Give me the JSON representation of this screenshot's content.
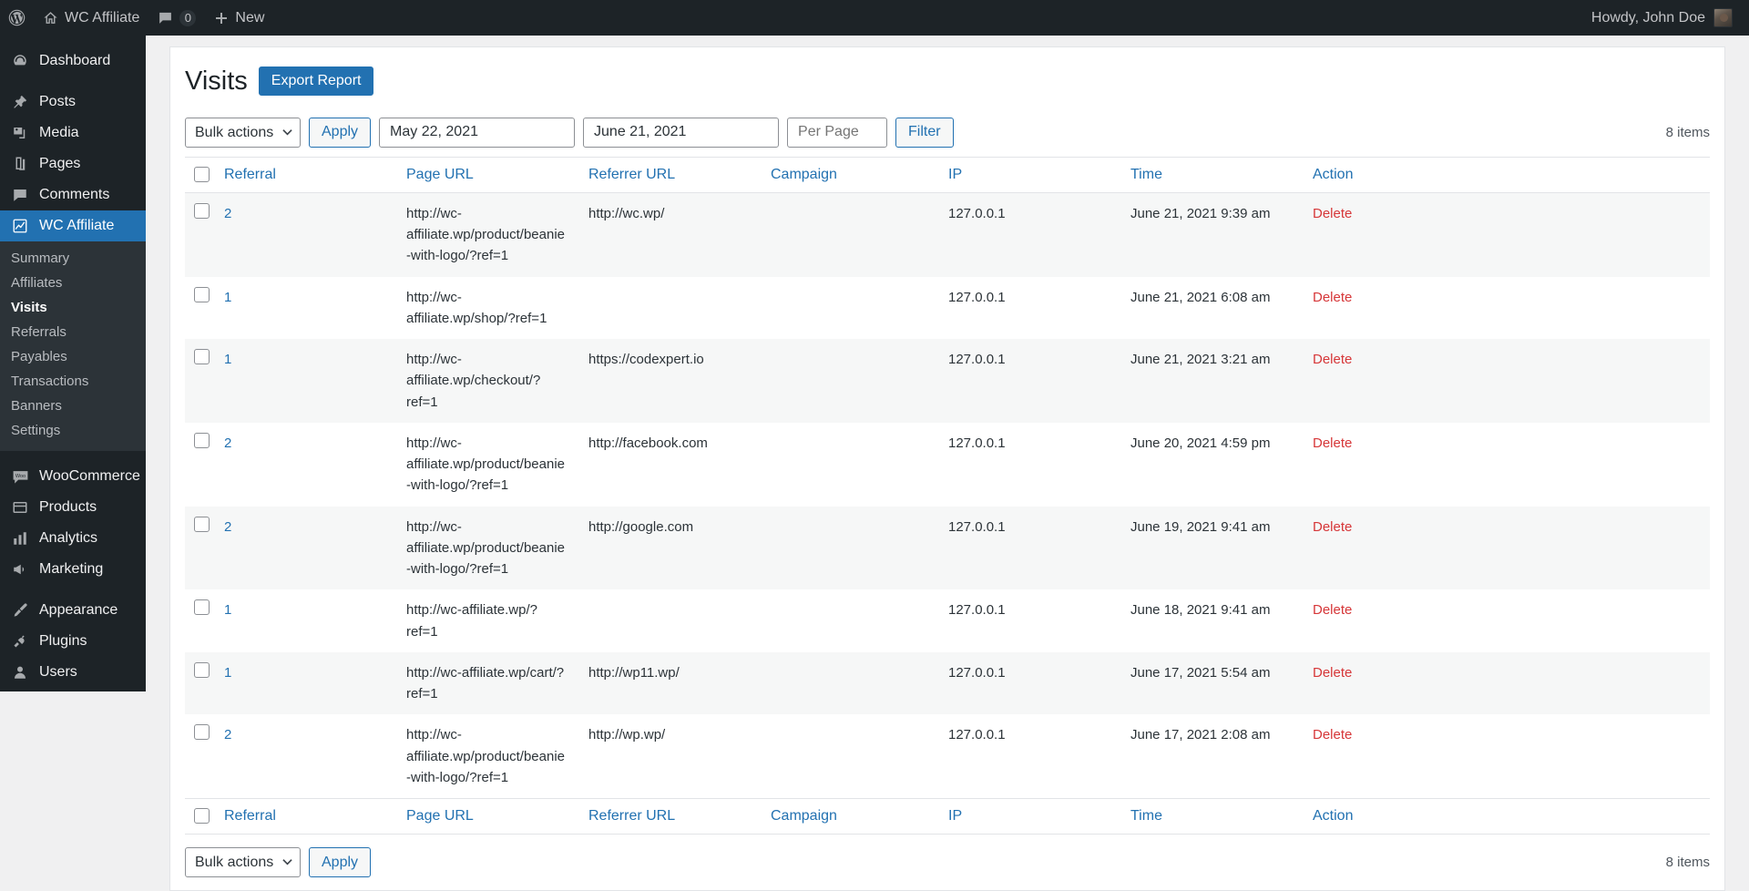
{
  "adminbar": {
    "logo_icon": "wordpress-icon",
    "site_icon": "home-icon",
    "site_name": "WC Affiliate",
    "comments_icon": "comment-icon",
    "comments_count": "0",
    "new_icon": "plus-icon",
    "new_label": "New",
    "howdy": "Howdy, John Doe",
    "avatar_name": "avatar"
  },
  "sidebar": {
    "items": [
      {
        "label": "Dashboard",
        "icon": "dashboard-icon",
        "current": false
      },
      {
        "label": "Posts",
        "icon": "pin-icon",
        "current": false
      },
      {
        "label": "Media",
        "icon": "media-icon",
        "current": false
      },
      {
        "label": "Pages",
        "icon": "pages-icon",
        "current": false
      },
      {
        "label": "Comments",
        "icon": "comment-icon",
        "current": false
      },
      {
        "label": "WC Affiliate",
        "icon": "chart-line-icon",
        "current": true
      },
      {
        "label": "WooCommerce",
        "icon": "woocommerce-icon",
        "current": false
      },
      {
        "label": "Products",
        "icon": "products-icon",
        "current": false
      },
      {
        "label": "Analytics",
        "icon": "bar-chart-icon",
        "current": false
      },
      {
        "label": "Marketing",
        "icon": "megaphone-icon",
        "current": false
      },
      {
        "label": "Appearance",
        "icon": "brush-icon",
        "current": false
      },
      {
        "label": "Plugins",
        "icon": "plug-icon",
        "current": false
      },
      {
        "label": "Users",
        "icon": "user-icon",
        "current": false
      }
    ],
    "submenu": [
      {
        "label": "Summary",
        "current": false
      },
      {
        "label": "Affiliates",
        "current": false
      },
      {
        "label": "Visits",
        "current": true
      },
      {
        "label": "Referrals",
        "current": false
      },
      {
        "label": "Payables",
        "current": false
      },
      {
        "label": "Transactions",
        "current": false
      },
      {
        "label": "Banners",
        "current": false
      },
      {
        "label": "Settings",
        "current": false
      }
    ]
  },
  "page": {
    "title": "Visits",
    "export_label": "Export Report"
  },
  "toolbar": {
    "bulk_actions_label": "Bulk actions",
    "apply_label": "Apply",
    "date_from": "May 22, 2021",
    "date_to": "June 21, 2021",
    "per_page_placeholder": "Per Page",
    "filter_label": "Filter",
    "items_count": "8 items"
  },
  "toolbar_bottom": {
    "bulk_actions_label": "Bulk actions",
    "apply_label": "Apply",
    "items_count": "8 items"
  },
  "table": {
    "columns": [
      "Referral",
      "Page URL",
      "Referrer URL",
      "Campaign",
      "IP",
      "Time",
      "Action"
    ],
    "rows": [
      {
        "referral": "2",
        "page_url": "http://wc-affiliate.wp/product/beanie-with-logo/?ref=1",
        "referrer_url": "http://wc.wp/",
        "campaign": "",
        "ip": "127.0.0.1",
        "time": "June 21, 2021 9:39 am",
        "action": "Delete"
      },
      {
        "referral": "1",
        "page_url": "http://wc-affiliate.wp/shop/?ref=1",
        "referrer_url": "",
        "campaign": "",
        "ip": "127.0.0.1",
        "time": "June 21, 2021 6:08 am",
        "action": "Delete"
      },
      {
        "referral": "1",
        "page_url": "http://wc-affiliate.wp/checkout/?ref=1",
        "referrer_url": "https://codexpert.io",
        "campaign": "",
        "ip": "127.0.0.1",
        "time": "June 21, 2021 3:21 am",
        "action": "Delete"
      },
      {
        "referral": "2",
        "page_url": "http://wc-affiliate.wp/product/beanie-with-logo/?ref=1",
        "referrer_url": "http://facebook.com",
        "campaign": "",
        "ip": "127.0.0.1",
        "time": "June 20, 2021 4:59 pm",
        "action": "Delete"
      },
      {
        "referral": "2",
        "page_url": "http://wc-affiliate.wp/product/beanie-with-logo/?ref=1",
        "referrer_url": "http://google.com",
        "campaign": "",
        "ip": "127.0.0.1",
        "time": "June 19, 2021 9:41 am",
        "action": "Delete"
      },
      {
        "referral": "1",
        "page_url": "http://wc-affiliate.wp/?ref=1",
        "referrer_url": "",
        "campaign": "",
        "ip": "127.0.0.1",
        "time": "June 18, 2021 9:41 am",
        "action": "Delete"
      },
      {
        "referral": "1",
        "page_url": "http://wc-affiliate.wp/cart/?ref=1",
        "referrer_url": "http://wp11.wp/",
        "campaign": "",
        "ip": "127.0.0.1",
        "time": "June 17, 2021 5:54 am",
        "action": "Delete"
      },
      {
        "referral": "2",
        "page_url": "http://wc-affiliate.wp/product/beanie-with-logo/?ref=1",
        "referrer_url": "http://wp.wp/",
        "campaign": "",
        "ip": "127.0.0.1",
        "time": "June 17, 2021 2:08 am",
        "action": "Delete"
      }
    ]
  },
  "colors": {
    "admin_bg": "#1d2327",
    "submenu_bg": "#2c3338",
    "accent": "#2271b1",
    "danger": "#d63638",
    "page_bg": "#f0f0f1"
  }
}
